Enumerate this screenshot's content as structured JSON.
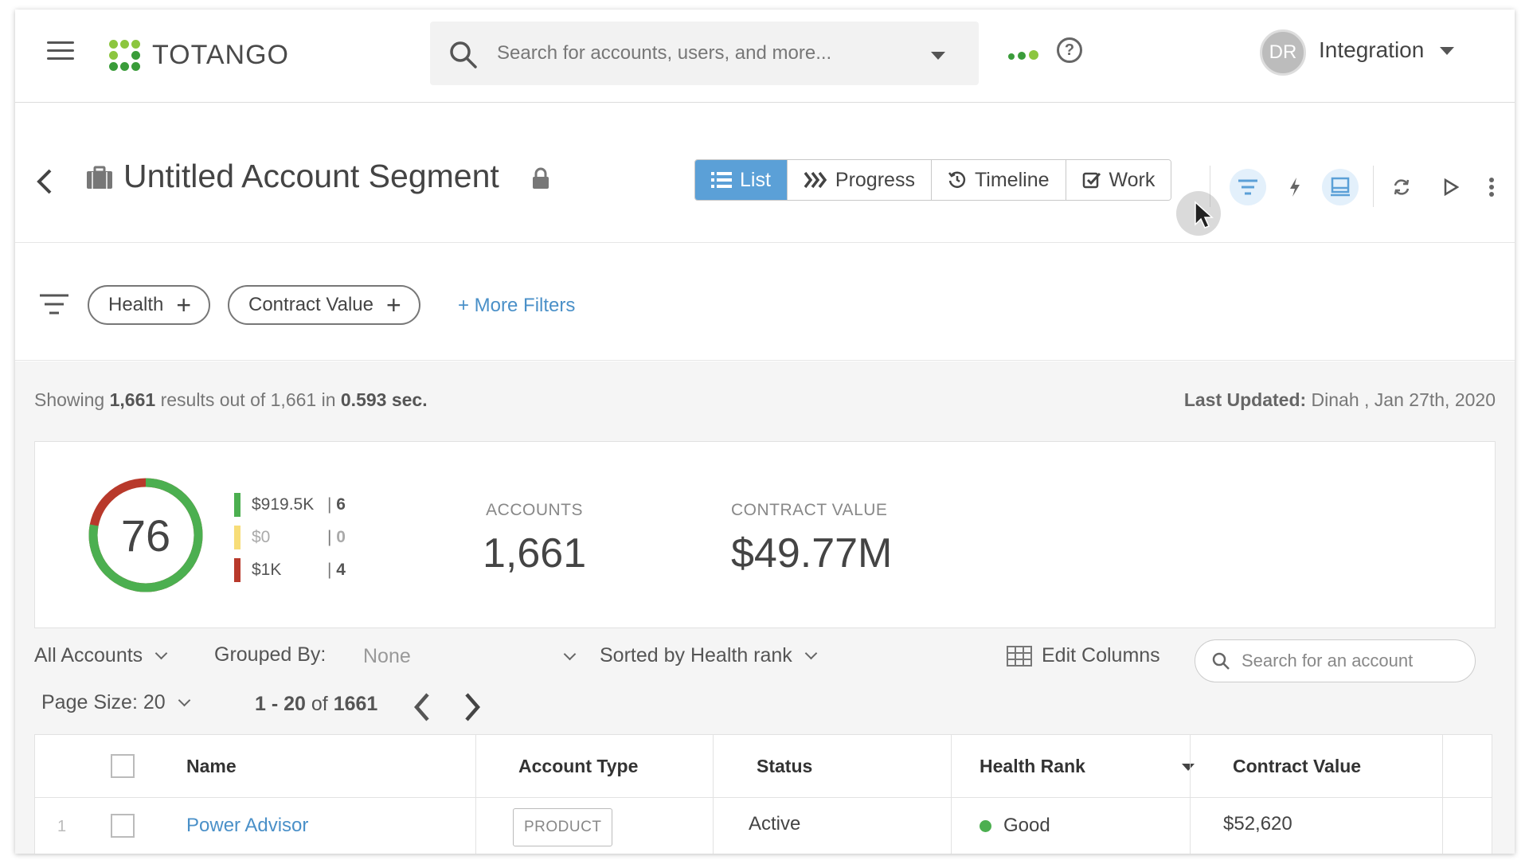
{
  "app": {
    "logo_text": "TOTANGO"
  },
  "search": {
    "placeholder": "Search for accounts, users, and more..."
  },
  "user": {
    "initials": "DR",
    "name": "Integration"
  },
  "segment": {
    "title": "Untitled Account Segment"
  },
  "view_tabs": [
    {
      "label": "List",
      "active": true,
      "icon": "list-icon"
    },
    {
      "label": "Progress",
      "active": false,
      "icon": "progress-chevrons-icon"
    },
    {
      "label": "Timeline",
      "active": false,
      "icon": "history-icon"
    },
    {
      "label": "Work",
      "active": false,
      "icon": "check-square-icon"
    }
  ],
  "filters": {
    "chips": [
      {
        "label": "Health"
      },
      {
        "label": "Contract Value"
      }
    ],
    "more_label": "+ More Filters"
  },
  "results": {
    "showing_prefix": "Showing",
    "shown": "1,661",
    "mid": "results out of 1,661 in",
    "time": "0.593 sec.",
    "last_updated_label": "Last Updated:",
    "last_updated_value": "Dinah , Jan 27th, 2020"
  },
  "summary": {
    "health_score": "76",
    "health_fraction_good": 0.78,
    "legend": [
      {
        "value": "$919.5K",
        "count": "6",
        "color": "#4caf50"
      },
      {
        "value": "$0",
        "count": "0",
        "color": "#f7dd78"
      },
      {
        "value": "$1K",
        "count": "4",
        "color": "#b8392b"
      }
    ],
    "accounts_label": "ACCOUNTS",
    "accounts_value": "1,661",
    "contract_label": "CONTRACT VALUE",
    "contract_value": "$49.77M"
  },
  "controls": {
    "scope": "All Accounts",
    "grouped_label": "Grouped By:",
    "grouped_value": "None",
    "sorted": "Sorted by Health rank",
    "edit_columns": "Edit Columns",
    "account_search_placeholder": "Search for an account",
    "page_size": "Page Size: 20",
    "range": "1 - 20",
    "range_of": "of",
    "total": "1661"
  },
  "table": {
    "columns": [
      "Name",
      "Account Type",
      "Status",
      "Health Rank",
      "Contract Value"
    ],
    "rows": [
      {
        "index": "1",
        "name": "Power Advisor",
        "type": "PRODUCT",
        "status": "Active",
        "health": "Good",
        "health_color": "#4caf50",
        "contract": "$52,620"
      }
    ]
  },
  "colors": {
    "accent": "#5ba0d7",
    "link": "#4a90c8"
  }
}
